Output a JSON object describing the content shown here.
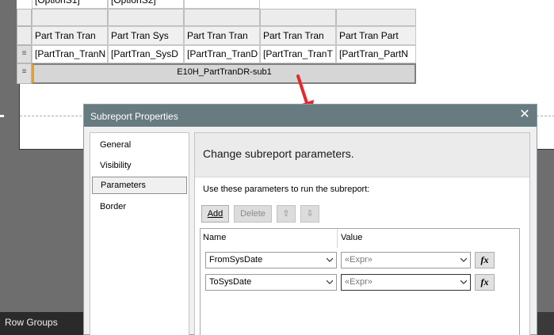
{
  "designer": {
    "option_cells": [
      "[OptionS1]",
      "[OptionS2]"
    ],
    "header_cells": [
      "Part Tran Tran",
      "Part Tran Sys",
      "Part Tran Tran",
      "Part Tran Tran",
      "Part Tran Part"
    ],
    "detail_cells": [
      "[PartTran_TranN",
      "[PartTran_SysD",
      "[PartTran_TranD",
      "[PartTran_TranT",
      "[PartTran_PartN"
    ],
    "row_handle_glyph": "≡",
    "subreport_name": "E10H_PartTranDR-sub1"
  },
  "bottom": {
    "row_groups_label": "Row Groups"
  },
  "dialog": {
    "title": "Subreport Properties",
    "close_glyph": "✕",
    "nav": [
      "General",
      "Visibility",
      "Parameters",
      "Border"
    ],
    "selected_nav": "Parameters",
    "heading": "Change subreport parameters.",
    "description": "Use these parameters to run the subreport:",
    "buttons": {
      "add": "Add",
      "delete": "Delete",
      "up_glyph": "⇧",
      "down_glyph": "⇩"
    },
    "columns": {
      "name": "Name",
      "value": "Value"
    },
    "parameters": [
      {
        "name": "FromSysDate",
        "value_placeholder": "«Expr»"
      },
      {
        "name": "ToSysDate",
        "value_placeholder": "«Expr»"
      }
    ],
    "fx_label": "fx"
  },
  "colors": {
    "dialog_title_bar": "#677b80",
    "arrow": "#e8262a",
    "subreport_accent": "#e0a030"
  }
}
